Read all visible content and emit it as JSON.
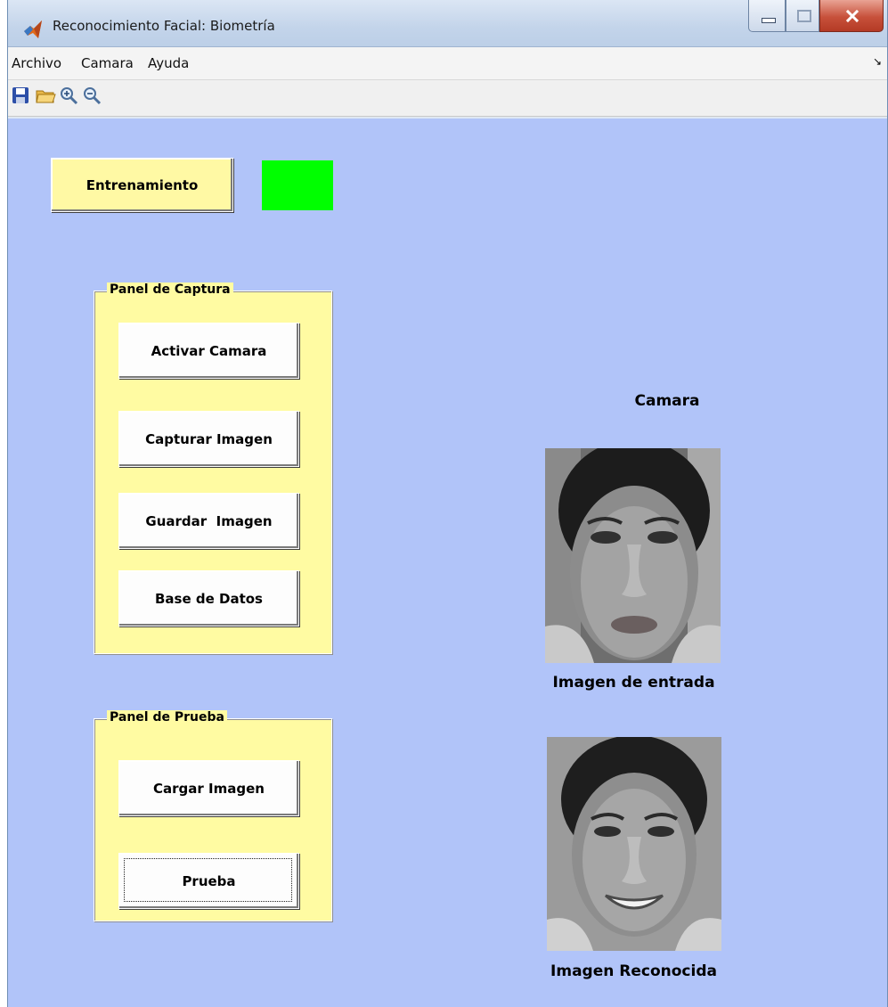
{
  "window": {
    "title": "Reconocimiento Facial: Biometría"
  },
  "menu": {
    "items": [
      "Archivo",
      "Camara",
      "Ayuda"
    ],
    "overflow_icon": "dock-arrow-icon"
  },
  "toolbar": {
    "icons": [
      "save-icon",
      "open-folder-icon",
      "zoom-in-icon",
      "zoom-out-icon"
    ]
  },
  "training": {
    "button_label": "Entrenamiento",
    "indicator_color": "#00ff00"
  },
  "capture_panel": {
    "title": "Panel de Captura",
    "buttons": [
      "Activar Camara",
      "Capturar Imagen",
      "Guardar  Imagen",
      "Base de Datos"
    ]
  },
  "test_panel": {
    "title": "Panel de Prueba",
    "buttons": [
      "Cargar Imagen",
      "Prueba"
    ]
  },
  "camera": {
    "label": "Camara"
  },
  "images": {
    "input_label": "Imagen de entrada",
    "recognized_label": "Imagen Reconocida"
  },
  "colors": {
    "background": "#b1c4f9",
    "button_yellow": "#fff9a4",
    "panel_yellow": "#fffba2"
  }
}
